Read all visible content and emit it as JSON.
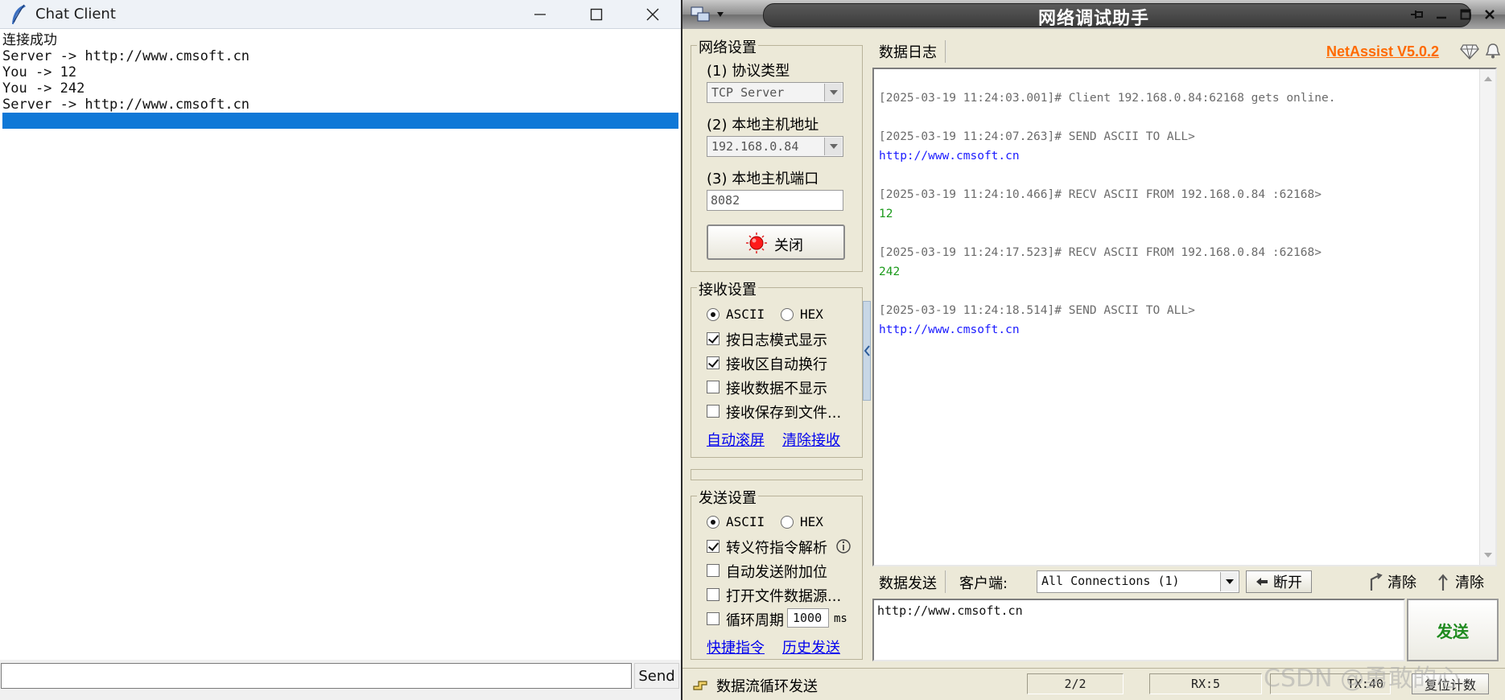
{
  "chat_client": {
    "title": "Chat Client",
    "log_lines": [
      "连接成功",
      "Server -> http://www.cmsoft.cn",
      "You -> 12",
      "You -> 242",
      "Server -> http://www.cmsoft.cn"
    ],
    "message_input": "",
    "send_label": "Send"
  },
  "netassist": {
    "title": "网络调试助手",
    "network_settings": {
      "group_title": "网络设置",
      "protocol_label": "(1) 协议类型",
      "protocol_value": "TCP Server",
      "host_label": "(2) 本地主机地址",
      "host_value": "192.168.0.84",
      "port_label": "(3) 本地主机端口",
      "port_value": "8082",
      "close_label": "关闭"
    },
    "receive_settings": {
      "group_title": "接收设置",
      "ascii": "ASCII",
      "hex": "HEX",
      "opt_log_mode": "按日志模式显示",
      "opt_auto_wrap": "接收区自动换行",
      "opt_hide_data": "接收数据不显示",
      "opt_save_file": "接收保存到文件...",
      "link_autoscroll": "自动滚屏",
      "link_clear": "清除接收"
    },
    "send_settings": {
      "group_title": "发送设置",
      "ascii": "ASCII",
      "hex": "HEX",
      "opt_escape": "转义符指令解析",
      "opt_append": "自动发送附加位",
      "opt_open_file": "打开文件数据源...",
      "opt_cycle": "循环周期",
      "cycle_value": "1000",
      "cycle_unit": "ms",
      "link_shortcut": "快捷指令",
      "link_history": "历史发送"
    },
    "log_tab": "数据日志",
    "version": "NetAssist V5.0.2",
    "log": [
      {
        "type": "head",
        "text": "[2025-03-19 11:24:03.001]# Client 192.168.0.84:62168 gets online."
      },
      {
        "type": "head",
        "text": "[2025-03-19 11:24:07.263]# SEND ASCII TO ALL>"
      },
      {
        "type": "send",
        "text": "http://www.cmsoft.cn"
      },
      {
        "type": "head",
        "text": "[2025-03-19 11:24:10.466]# RECV ASCII FROM 192.168.0.84 :62168>"
      },
      {
        "type": "recv",
        "text": "12"
      },
      {
        "type": "head",
        "text": "[2025-03-19 11:24:17.523]# RECV ASCII FROM 192.168.0.84 :62168>"
      },
      {
        "type": "recv",
        "text": "242"
      },
      {
        "type": "head",
        "text": "[2025-03-19 11:24:18.514]# SEND ASCII TO ALL>"
      },
      {
        "type": "send",
        "text": "http://www.cmsoft.cn"
      }
    ],
    "send_tab": "数据发送",
    "client_label": "客户端:",
    "client_select": "All Connections (1)",
    "disconnect_label": "断开",
    "clear1_label": "清除",
    "clear2_label": "清除",
    "send_text": "http://www.cmsoft.cn",
    "send_button": "发送",
    "status": {
      "cycle_text": "数据流循环发送",
      "page": "2/2",
      "rx": "RX:5",
      "tx": "TX:40",
      "reset": "复位计数"
    },
    "watermark": "CSDN @勇敢的心"
  },
  "colors": {
    "selection": "#0f78d7",
    "send_text": "#1a1aff",
    "recv_text": "#1b9a1b",
    "version": "#ff6a00",
    "send_button_text": "#1d8a1d",
    "link": "#0000ee"
  }
}
